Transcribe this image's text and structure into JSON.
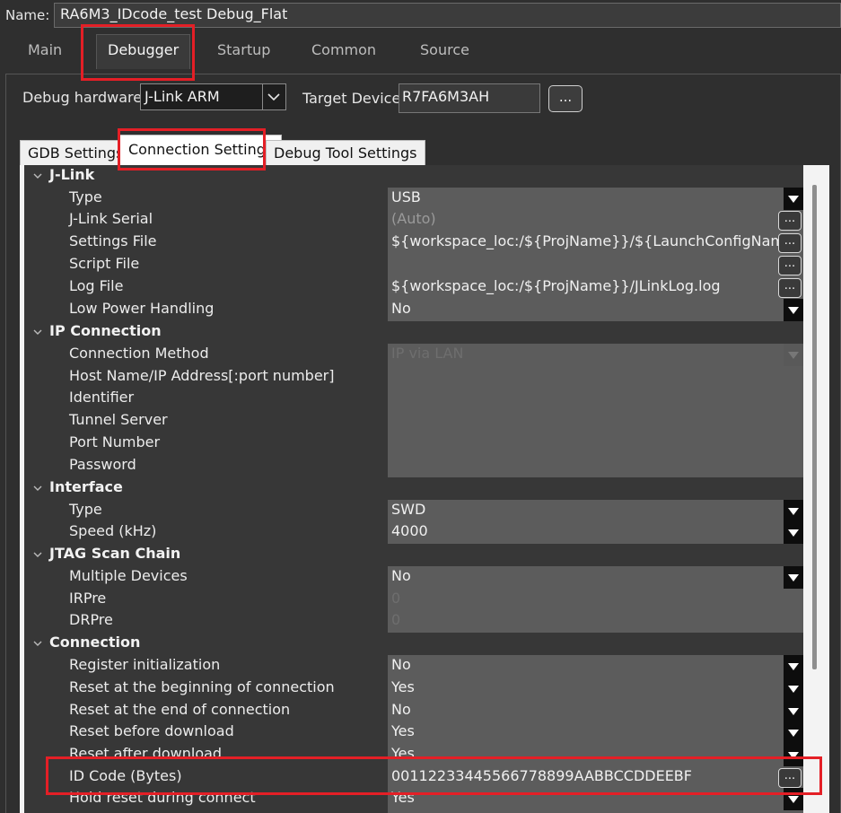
{
  "name": {
    "label": "Name:",
    "value": "RA6M3_IDcode_test Debug_Flat"
  },
  "main_tabs": [
    "Main",
    "Debugger",
    "Startup",
    "Common",
    "Source"
  ],
  "debug_hardware": {
    "label": "Debug hardware:",
    "value": "J-Link ARM"
  },
  "target_device": {
    "label": "Target Device:",
    "value": "R7FA6M3AH",
    "browse": "..."
  },
  "sub_tabs": [
    "GDB Settings",
    "Connection Settings",
    "Debug Tool Settings"
  ],
  "grid": {
    "jlink": {
      "title": "J-Link",
      "type": {
        "label": "Type",
        "value": "USB"
      },
      "serial": {
        "label": "J-Link Serial",
        "value": "(Auto)"
      },
      "settings_file": {
        "label": "Settings File",
        "value": "${workspace_loc:/${ProjName}}/${LaunchConfigName}.jlink"
      },
      "script_file": {
        "label": "Script File",
        "value": ""
      },
      "log_file": {
        "label": "Log File",
        "value": "${workspace_loc:/${ProjName}}/JLinkLog.log"
      },
      "low_power": {
        "label": "Low Power Handling",
        "value": "No"
      }
    },
    "ip": {
      "title": "IP Connection",
      "method": {
        "label": "Connection Method",
        "value": "IP via LAN"
      },
      "host": {
        "label": "Host Name/IP Address[:port number]"
      },
      "identifier": {
        "label": "Identifier"
      },
      "tunnel": {
        "label": "Tunnel Server"
      },
      "port": {
        "label": "Port Number"
      },
      "password": {
        "label": "Password"
      }
    },
    "interface": {
      "title": "Interface",
      "type": {
        "label": "Type",
        "value": "SWD"
      },
      "speed": {
        "label": "Speed (kHz)",
        "value": "4000"
      }
    },
    "jtag": {
      "title": "JTAG Scan Chain",
      "multiple": {
        "label": "Multiple Devices",
        "value": "No"
      },
      "irpre": {
        "label": "IRPre",
        "value": "0"
      },
      "drpre": {
        "label": "DRPre",
        "value": "0"
      }
    },
    "connection": {
      "title": "Connection",
      "reg_init": {
        "label": "Register initialization",
        "value": "No"
      },
      "reset_begin": {
        "label": "Reset at the beginning of connection",
        "value": "Yes"
      },
      "reset_end": {
        "label": "Reset at the end of connection",
        "value": "No"
      },
      "reset_before": {
        "label": "Reset before download",
        "value": "Yes"
      },
      "reset_after": {
        "label": "Reset after download",
        "value": "Yes"
      },
      "id_code": {
        "label": "ID Code (Bytes)",
        "value": "00112233445566778899AABBCCDDEEBF"
      },
      "hold_reset": {
        "label": "Hold reset during connect",
        "value": "Yes"
      }
    }
  },
  "ellipsis": "...",
  "colors": {
    "highlight": "#e41f26",
    "grid_bg": "#373737",
    "value_bg": "#5c5c5c"
  }
}
